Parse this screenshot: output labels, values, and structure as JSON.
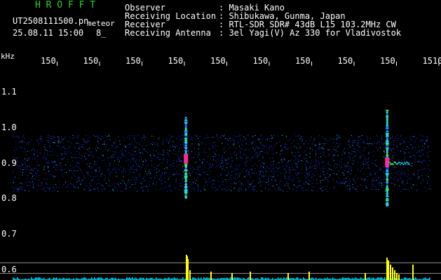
{
  "header": {
    "logo_text": "H R O F F T",
    "file_name": "UT2508111500.pn",
    "detection_type": "meteor",
    "datetime": "25.08.11 15:00",
    "count": "8_"
  },
  "info": {
    "observer_label": "Observer",
    "observer_value": ": Masaki Kano",
    "location_label": "Receiving Location",
    "location_value": ": Shibukawa, Gunma, Japan",
    "receiver_label": "Receiver",
    "receiver_value": ": RTL-SDR SDR# 43dB L15 103.2MHz CW",
    "antenna_label": "Receiving Antenna",
    "antenna_value": ": 3el Yagi(V) Az 330 for Vladivostok"
  },
  "colors": {
    "logo": "#28d228",
    "text": "#ffffff",
    "background": "#000000",
    "noise_blue": "#1e3cff",
    "echo_cyan": "#1ee0ff",
    "echo_green": "#3cff5a",
    "echo_magenta": "#ff2a9a",
    "bar_yellow": "#ffff00",
    "baseline_cyan": "#00e0ff"
  },
  "chart_data": {
    "type": "heatmap",
    "ylabel": "kHz",
    "y_ticks": [
      "1.1",
      "1.0",
      "0.9",
      "0.8",
      "0.7",
      "0.6"
    ],
    "x_ticks": [
      "150",
      "150",
      "150",
      "150",
      "150",
      "150",
      "150",
      "150",
      "150",
      "1510"
    ],
    "ylim": [
      0.57,
      1.17
    ],
    "noise_band": [
      0.82,
      0.98
    ],
    "echoes": [
      {
        "time_index": 0.42,
        "freq_low": 0.8,
        "freq_high": 1.03,
        "peak_freq": 0.91,
        "strength": 0.95
      },
      {
        "time_index": 0.878,
        "freq_low": 0.78,
        "freq_high": 1.05,
        "peak_freq": 0.9,
        "strength": 1.0
      }
    ],
    "reference_lines": [
      0.62,
      0.59
    ]
  }
}
